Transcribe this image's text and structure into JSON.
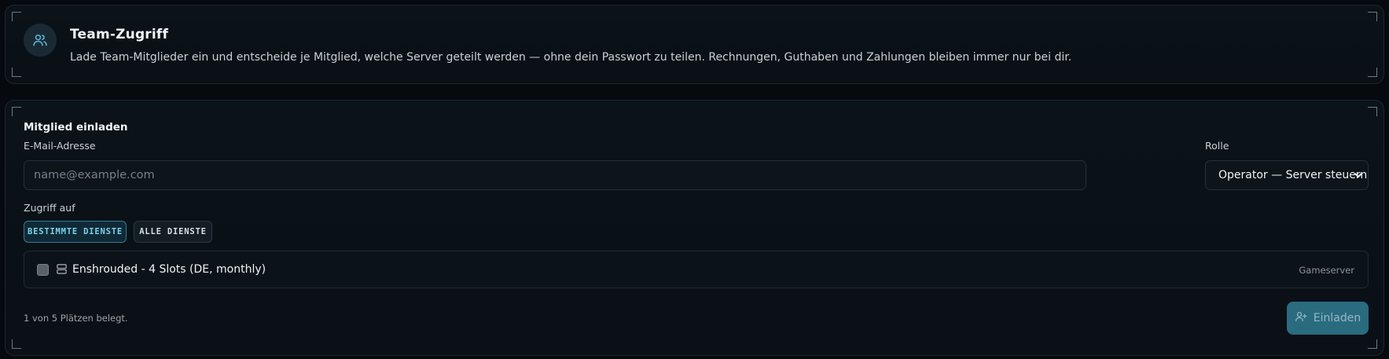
{
  "header": {
    "title": "Team-Zugriff",
    "description": "Lade Team-Mitglieder ein und entscheide je Mitglied, welche Server geteilt werden — ohne dein Passwort zu teilen. Rechnungen, Guthaben und Zahlungen bleiben immer nur bei dir.",
    "icon": "users-icon"
  },
  "invite": {
    "title": "Mitglied einladen",
    "email_label": "E-Mail-Adresse",
    "email_placeholder": "name@example.com",
    "email_value": "",
    "role_label": "Rolle",
    "role_selected": "Operator — Server steuern",
    "access_label": "Zugriff auf",
    "access_options": [
      {
        "label": "BESTIMMTE DIENSTE",
        "active": true
      },
      {
        "label": "ALLE DIENSTE",
        "active": false
      }
    ],
    "services": [
      {
        "name": "Enshrouded - 4 Slots (DE, monthly)",
        "type": "Gameserver",
        "checked": false,
        "icon": "server-icon"
      }
    ],
    "seats_text": "1 von 5 Plätzen belegt.",
    "submit_label": "Einladen",
    "submit_icon": "user-plus-icon"
  },
  "colors": {
    "accent": "#2a6b80",
    "active_tab_text": "#7fd0ea",
    "background": "#06090d"
  }
}
